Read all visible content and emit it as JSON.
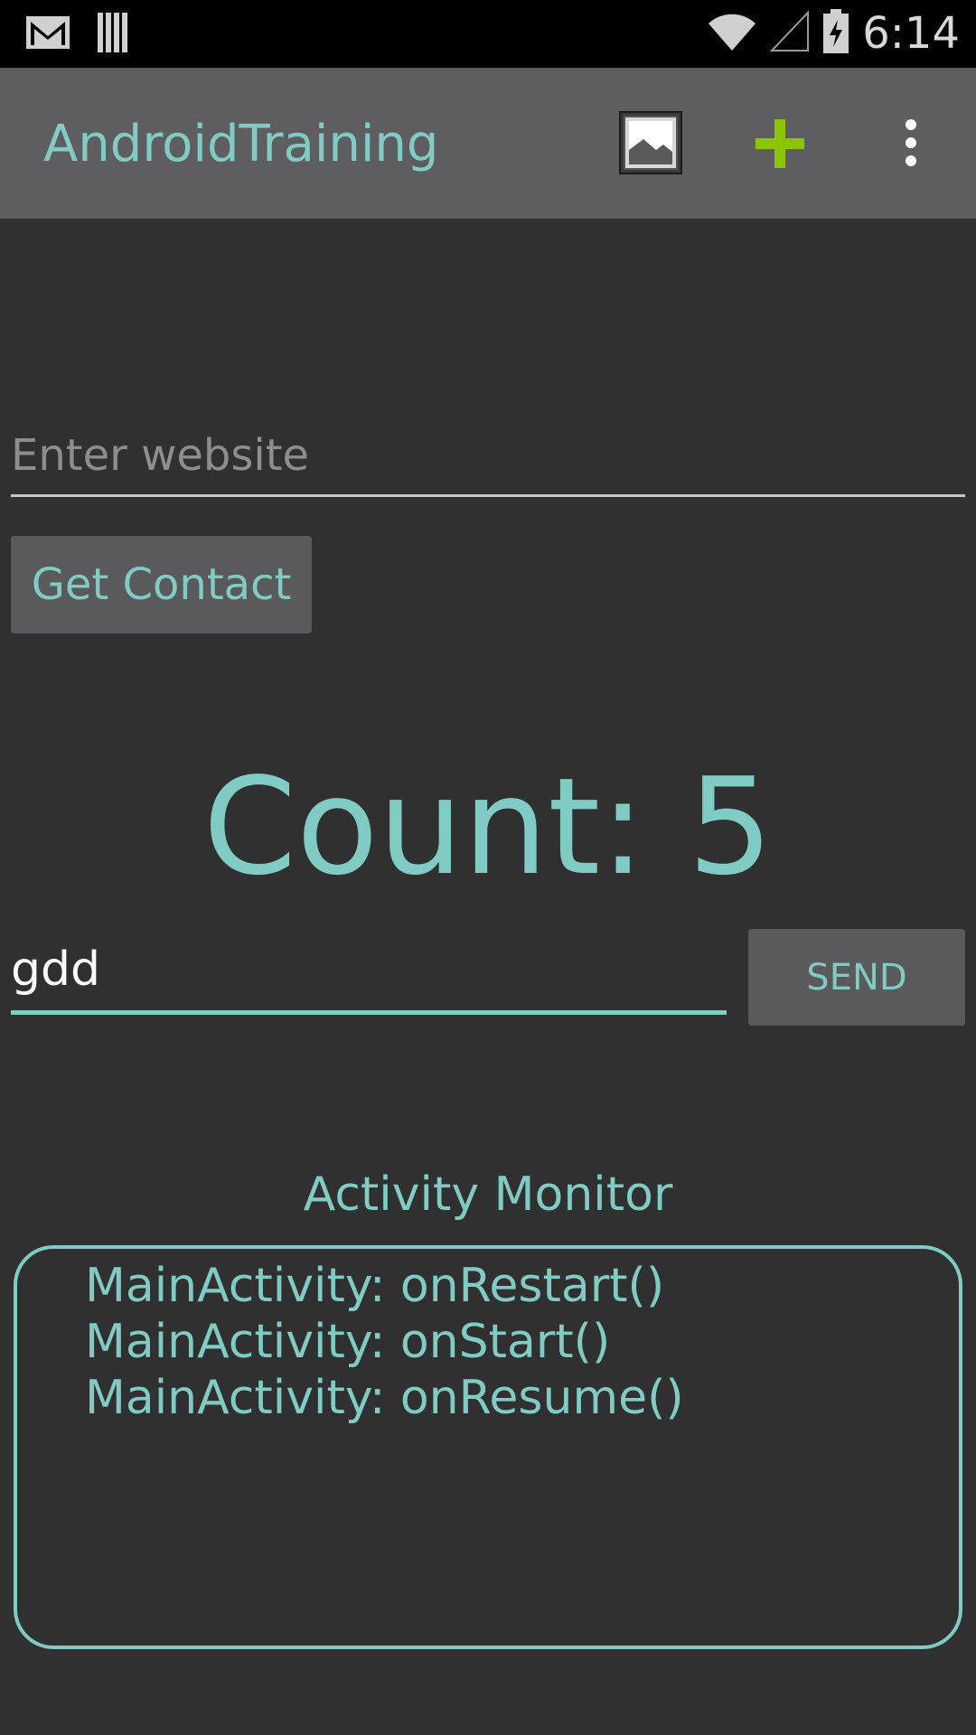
{
  "status_bar": {
    "time": "6:14",
    "icons": [
      "gmail-icon",
      "barcode-icon",
      "wifi-icon",
      "cell-signal-icon",
      "battery-charging-icon"
    ]
  },
  "action_bar": {
    "title": "AndroidTraining",
    "actions": [
      "image-icon",
      "add-icon",
      "overflow-menu-icon"
    ]
  },
  "form": {
    "website_placeholder": "Enter website",
    "get_contact_label": "Get Contact"
  },
  "counter": {
    "label": "Count: 5"
  },
  "message": {
    "value": "gdd",
    "send_label": "SEND"
  },
  "activity_monitor": {
    "title": "Activity Monitor",
    "entries": [
      "MainActivity: onRestart()",
      "MainActivity: onStart()",
      "MainActivity: onResume()"
    ]
  },
  "colors": {
    "accent": "#80cbc4",
    "background": "#303030",
    "action_bar": "#5e5e60",
    "add_icon": "#8bc400"
  }
}
